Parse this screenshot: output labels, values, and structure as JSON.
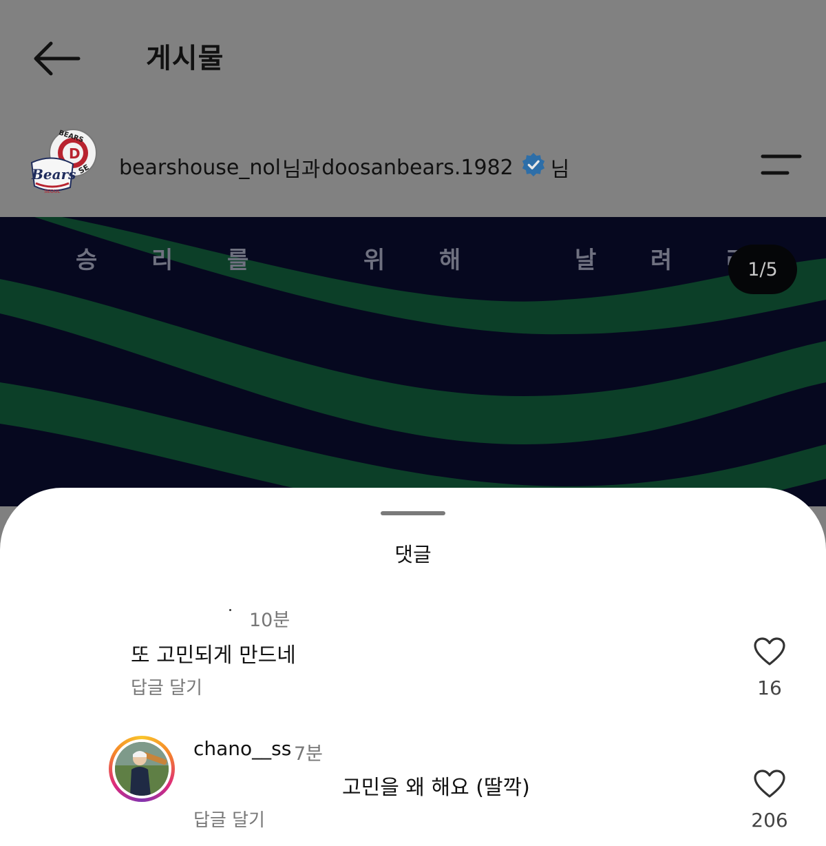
{
  "header": {
    "title": "게시물",
    "account_1": "bearshouse_nol",
    "connector": "님과",
    "account_2": "doosanbears.1982",
    "suffix": "님",
    "back_icon": "arrow-left-icon",
    "menu_icon": "menu-lines-icon",
    "verified_icon": "verified-badge-icon"
  },
  "post": {
    "slogan": [
      "승",
      "리",
      "를",
      "위",
      "해",
      "날",
      "려",
      "라"
    ],
    "pager": "1/5"
  },
  "comments_sheet": {
    "title": "댓글",
    "comments": [
      {
        "time": "10분",
        "text": "또 고민되게 만드네",
        "reply_label": "답글 달기",
        "likes": "16"
      },
      {
        "username": "chano__ss",
        "time": "7분",
        "text": "고민을 왜 해요 (딸깍)",
        "reply_label": "답글 달기",
        "likes": "206"
      }
    ]
  },
  "colors": {
    "header_bg": "#818181",
    "banner_bg": "#06081f",
    "stripe_green": "#0d4a2e",
    "verified_blue": "#0095f6"
  }
}
